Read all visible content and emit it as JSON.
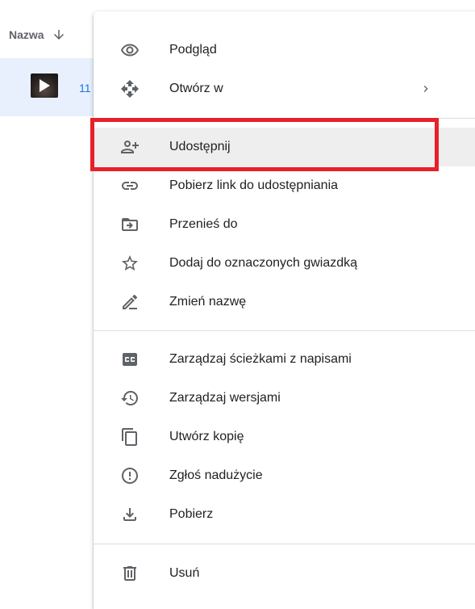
{
  "file_list": {
    "sort_column_label": "Nazwa",
    "sort_icon": "arrow-down-icon",
    "file": {
      "name": "11",
      "icon": "video-play-icon"
    }
  },
  "menu": {
    "groups": [
      [
        {
          "label": "Podgląd",
          "icon": "eye-icon"
        },
        {
          "label": "Otwórz w",
          "icon": "open-with-icon",
          "submenu_indicator": "›"
        }
      ],
      [
        {
          "label": "Udostępnij",
          "icon": "person-add-icon",
          "highlighted": true
        },
        {
          "label": "Pobierz link do udostępniania",
          "icon": "link-icon"
        },
        {
          "label": "Przenieś do",
          "icon": "move-to-folder-icon"
        },
        {
          "label": "Dodaj do oznaczonych gwiazdką",
          "icon": "star-outline-icon"
        },
        {
          "label": "Zmień nazwę",
          "icon": "pencil-icon"
        }
      ],
      [
        {
          "label": "Zarządzaj ścieżkami z napisami",
          "icon": "closed-caption-icon"
        },
        {
          "label": "Zarządzaj wersjami",
          "icon": "history-icon"
        },
        {
          "label": "Utwórz kopię",
          "icon": "copy-icon"
        },
        {
          "label": "Zgłoś nadużycie",
          "icon": "report-icon"
        },
        {
          "label": "Pobierz",
          "icon": "download-icon"
        }
      ],
      [
        {
          "label": "Usuń",
          "icon": "trash-icon"
        }
      ]
    ]
  },
  "colors": {
    "selected_file_bg": "#e8f0fe",
    "link_text": "#1a73e8",
    "menu_hover_bg": "#eeeeee",
    "highlight_border": "#e8202a",
    "icon": "#5f6368"
  }
}
